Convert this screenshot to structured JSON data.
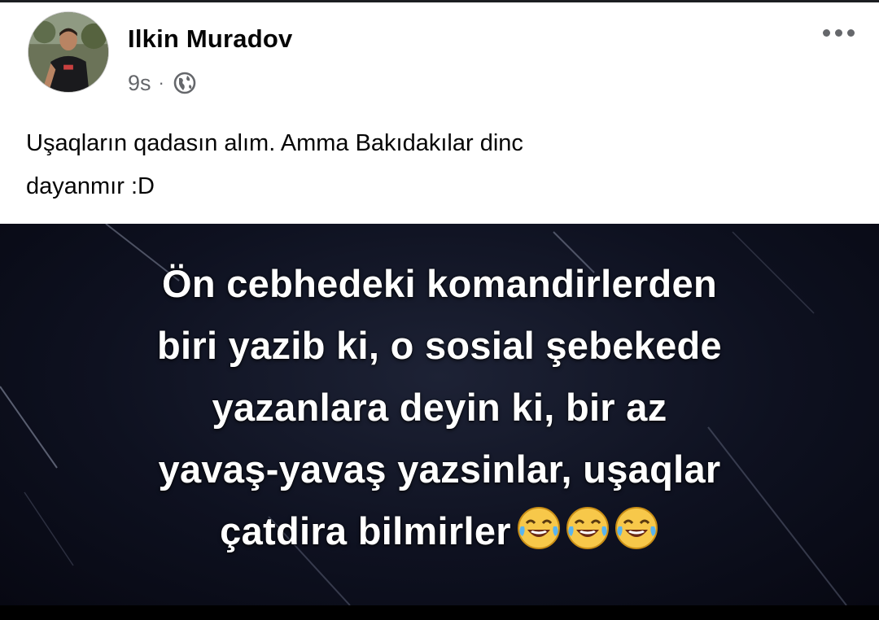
{
  "post": {
    "author": "Ilkin Muradov",
    "timestamp": "9s",
    "separator": "·",
    "privacy_icon": "globe-icon",
    "more_icon": "more-horizontal-icon",
    "text_lines": [
      "Uşaqların qadasın alım. Amma Bakıdakılar dinc",
      "dayanmır :D"
    ]
  },
  "image": {
    "lines": [
      "Ön cebhedeki komandirlerden",
      "biri yazib ki, o sosial şebekede",
      "yazanlara deyin ki, bir az",
      "yavaş-yavaş yazsinlar, uşaqlar",
      "çatdira bilmirler"
    ],
    "emoji": [
      "face-with-tears-of-joy",
      "face-with-tears-of-joy",
      "face-with-tears-of-joy"
    ]
  },
  "colors": {
    "name_text": "#050505",
    "meta_text": "#65676b",
    "image_background": "#0e1120",
    "image_text": "#ffffff"
  }
}
